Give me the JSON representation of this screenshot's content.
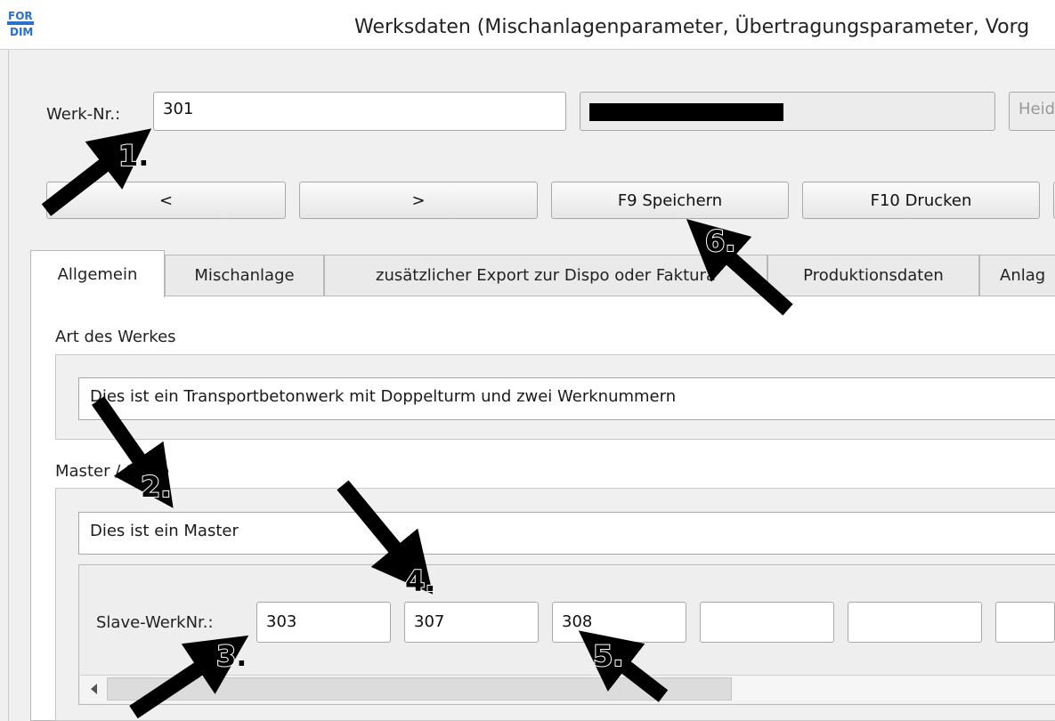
{
  "window": {
    "title": "Werksdaten (Mischanlagenparameter, Übertragungsparameter, Vorg"
  },
  "header": {
    "werk_label": "Werk-Nr.:",
    "werk_value": "301",
    "redacted_name": "",
    "extra_field_value": "Heid"
  },
  "toolbar": {
    "prev_label": "<",
    "next_label": ">",
    "save_label": "F9 Speichern",
    "print_label": "F10 Drucken"
  },
  "tabs": [
    {
      "label": "Allgemein",
      "active": true
    },
    {
      "label": "Mischanlage"
    },
    {
      "label": "zusätzlicher Export zur Dispo oder Faktura"
    },
    {
      "label": "Produktionsdaten"
    },
    {
      "label": "Anlag"
    }
  ],
  "general": {
    "art_label": "Art des Werkes",
    "art_value": "Dies ist ein Transportbetonwerk mit Doppelturm und zwei Werknummern",
    "master_label": "Master / Slave",
    "master_value": "Dies ist ein Master",
    "slave_label": "Slave-WerkNr.:",
    "slave_values": [
      "303",
      "307",
      "308",
      "",
      "",
      ""
    ]
  },
  "annotations": [
    "1.",
    "2.",
    "3.",
    "4.",
    "5.",
    "6."
  ],
  "colors": {
    "arrow": "#000000",
    "redaction": "#000000",
    "window_bg": "#f0f0f0"
  }
}
